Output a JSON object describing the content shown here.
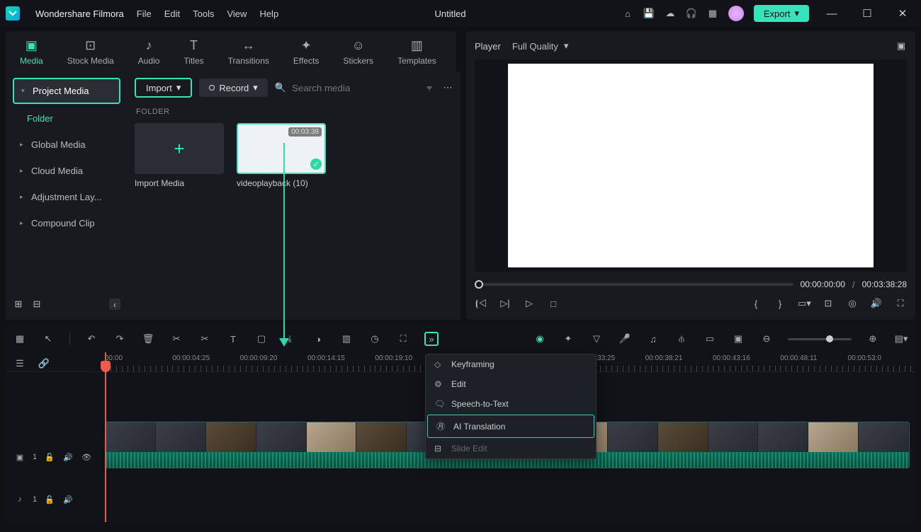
{
  "app": {
    "name": "Wondershare Filmora",
    "document": "Untitled"
  },
  "menus": [
    "File",
    "Edit",
    "Tools",
    "View",
    "Help"
  ],
  "export": "Export",
  "tabs": [
    {
      "label": "Media",
      "active": true
    },
    {
      "label": "Stock Media"
    },
    {
      "label": "Audio"
    },
    {
      "label": "Titles"
    },
    {
      "label": "Transitions"
    },
    {
      "label": "Effects"
    },
    {
      "label": "Stickers"
    },
    {
      "label": "Templates"
    }
  ],
  "sidebar": {
    "project": "Project Media",
    "folder": "Folder",
    "items": [
      "Global Media",
      "Cloud Media",
      "Adjustment Lay...",
      "Compound Clip"
    ]
  },
  "media": {
    "import": "Import",
    "record": "Record",
    "search_ph": "Search media",
    "folder_label": "FOLDER",
    "import_tile": "Import Media",
    "clip_name": "videoplayback (10)",
    "clip_dur": "00:03:38"
  },
  "preview": {
    "label": "Player",
    "quality": "Full Quality",
    "current": "00:00:00:00",
    "total": "00:03:38:28"
  },
  "ruler": [
    "00:00",
    "00:00:04:25",
    "00:00:09:20",
    "00:00:14:15",
    "00:00:19:10",
    "",
    "",
    "00:00:33:25",
    "00:00:38:21",
    "00:00:43:16",
    "00:00:48:11",
    "00:00:53:0"
  ],
  "ctx": {
    "keyframing": "Keyframing",
    "edit": "Edit",
    "stt": "Speech-to-Text",
    "ai": "AI Translation",
    "slide": "Slide Edit"
  },
  "track": {
    "v": "1",
    "a": "1"
  }
}
